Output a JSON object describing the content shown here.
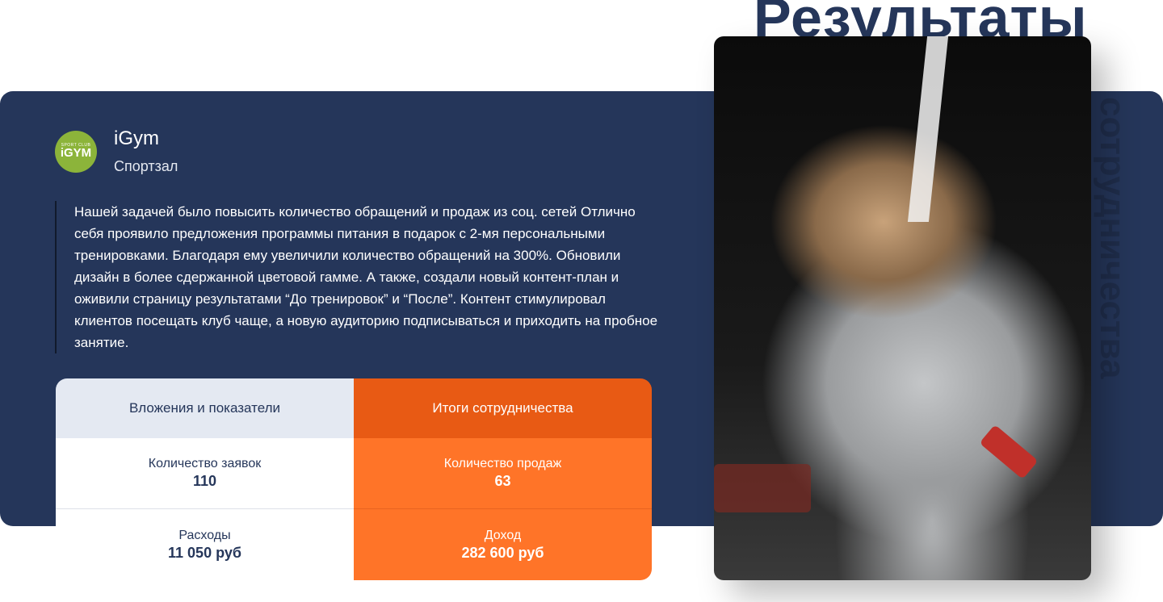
{
  "heading": {
    "title": "Результаты",
    "vertical": "сотрудничества"
  },
  "client": {
    "logo_small": "SPORT CLUB",
    "logo_big": "iGYM",
    "name": "iGym",
    "category": "Спортзал"
  },
  "description": "Нашей задачей было повысить количество обращений и продаж из соц. сетей Отлично себя проявило предложения программы питания в подарок с 2-мя персональными тренировками. Благодаря ему увеличили количество обращений на 300%.  Обновили дизайн в более сдержанной цветовой гамме. А также, создали новый контент-план и оживили страницу результатами “До тренировок” и “После”. Контент стимулировал клиентов посещать клуб чаще, а новую аудиторию подписываться и приходить на пробное занятие.",
  "table": {
    "left_header": "Вложения и показатели",
    "right_header": "Итоги сотрудничества",
    "rows": [
      {
        "left_label": "Количество заявок",
        "left_value": "110",
        "right_label": "Количество продаж",
        "right_value": "63"
      },
      {
        "left_label": "Расходы",
        "left_value": "11 050 руб",
        "right_label": "Доход",
        "right_value": "282 600 руб"
      }
    ]
  },
  "colors": {
    "navy": "#25365a",
    "orange": "#ff7428",
    "orange_dark": "#e85a14",
    "green": "#8cb43a"
  }
}
